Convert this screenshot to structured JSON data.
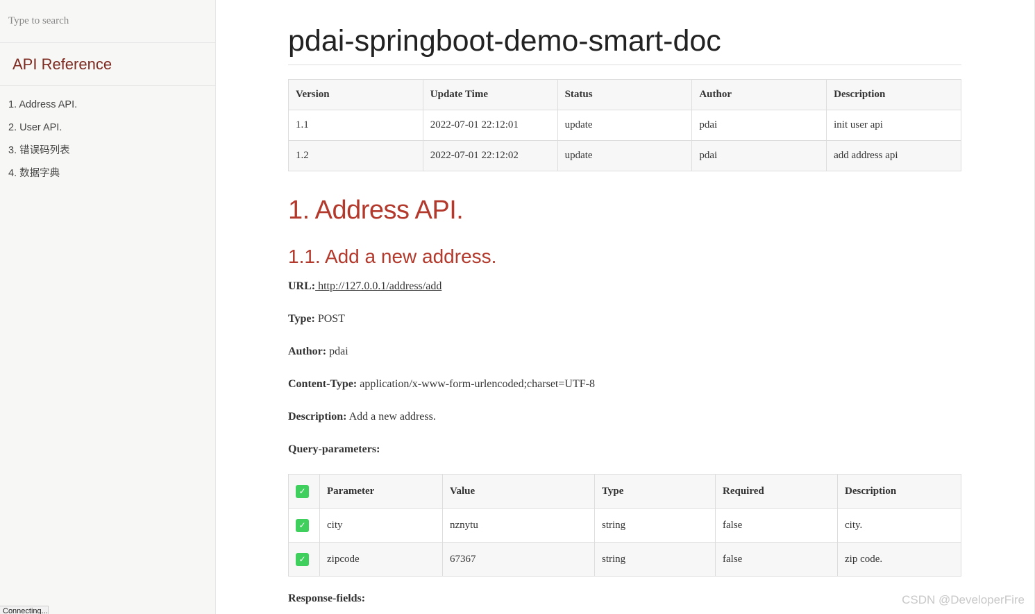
{
  "sidebar": {
    "search_placeholder": "Type to search",
    "heading": "API Reference",
    "items": [
      {
        "label": "1. Address API."
      },
      {
        "label": "2. User API."
      },
      {
        "label": "3. 错误码列表"
      },
      {
        "label": "4. 数据字典"
      }
    ]
  },
  "main": {
    "title": "pdai-springboot-demo-smart-doc",
    "version_table": {
      "headers": [
        "Version",
        "Update Time",
        "Status",
        "Author",
        "Description"
      ],
      "rows": [
        [
          "1.1",
          "2022-07-01 22:12:01",
          "update",
          "pdai",
          "init user api"
        ],
        [
          "1.2",
          "2022-07-01 22:12:02",
          "update",
          "pdai",
          "add address api"
        ]
      ]
    },
    "section_heading": "1. Address API.",
    "subsection_heading": "1.1. Add a new address.",
    "meta": {
      "url_label": "URL:",
      "url_value": " http://127.0.0.1/address/add",
      "type_label": "Type:",
      "type_value": "POST",
      "author_label": "Author:",
      "author_value": "pdai",
      "content_type_label": "Content-Type:",
      "content_type_value": "application/x-www-form-urlencoded;charset=UTF-8",
      "description_label": "Description:",
      "description_value": "Add a new address.",
      "query_params_label": "Query-parameters:",
      "response_fields_label": "Response-fields:"
    },
    "param_table": {
      "check_glyph": "✓",
      "headers": [
        "Parameter",
        "Value",
        "Type",
        "Required",
        "Description"
      ],
      "rows": [
        [
          "city",
          "nznytu",
          "string",
          "false",
          "city."
        ],
        [
          "zipcode",
          "67367",
          "string",
          "false",
          "zip code."
        ]
      ]
    }
  },
  "watermark": "CSDN @DeveloperFire",
  "status_bar": "Connecting...",
  "colors": {
    "heading_red": "#b2392b",
    "api_reference": "#7d2a20",
    "checkbox_green": "#3ecf5d",
    "sidebar_bg": "#f7f7f5"
  }
}
